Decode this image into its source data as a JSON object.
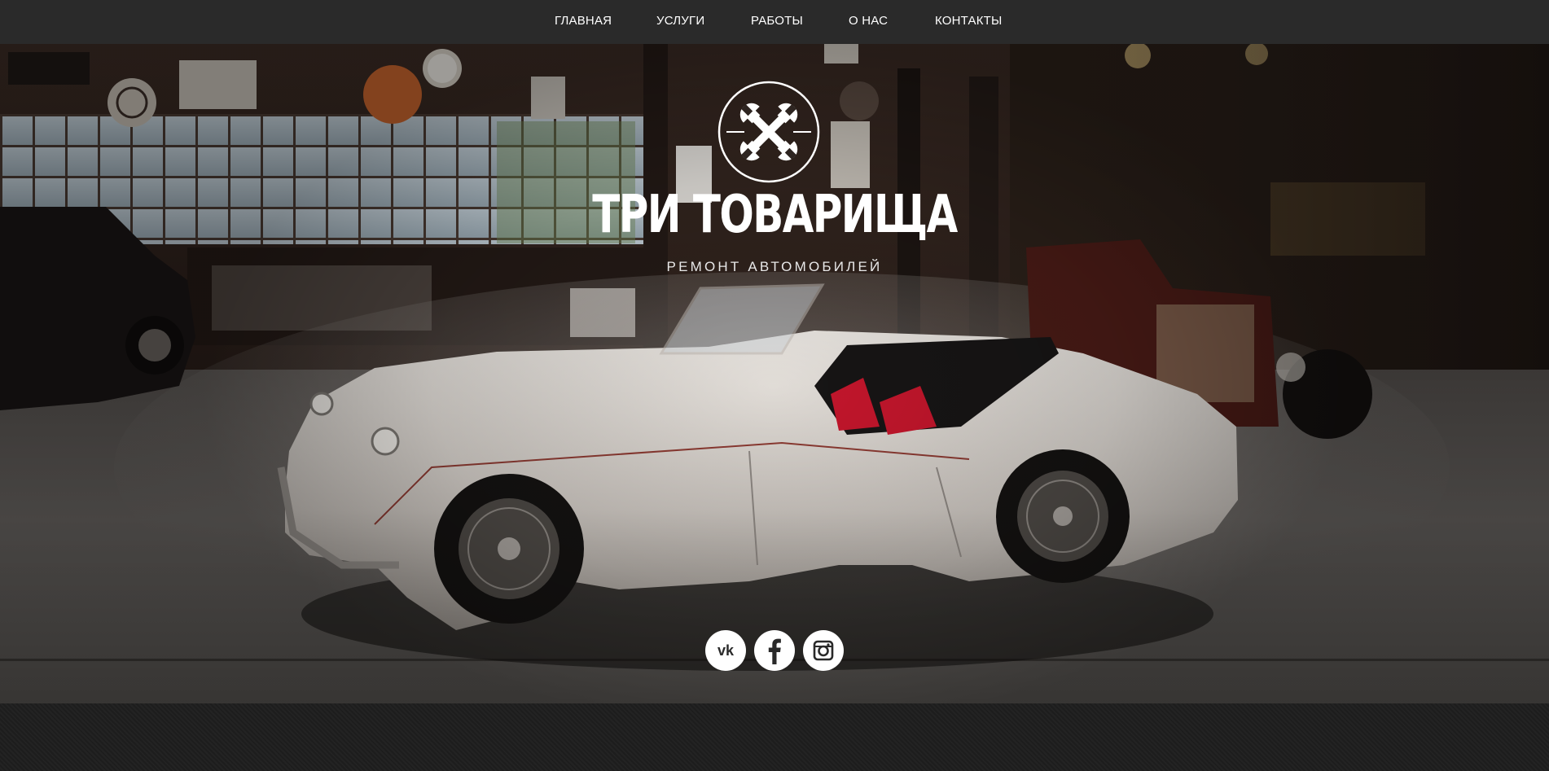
{
  "nav": {
    "items": [
      {
        "label": "ГЛАВНАЯ"
      },
      {
        "label": "УСЛУГИ"
      },
      {
        "label": "РАБОТЫ"
      },
      {
        "label": "О НАС"
      },
      {
        "label": "КОНТАКТЫ"
      }
    ]
  },
  "hero": {
    "title": "ТРИ ТОВАРИЩА",
    "subtitle": "РЕМОНТ АВТОМОБИЛЕЙ",
    "logo_icon": "crossed-wrenches-icon"
  },
  "social": [
    {
      "icon": "vk-icon"
    },
    {
      "icon": "facebook-icon"
    },
    {
      "icon": "instagram-icon"
    }
  ],
  "colors": {
    "nav_bg": "#2a2a2a",
    "text": "#ffffff",
    "car_body": "#d7d2cc",
    "seat_red": "#c4162c",
    "bottom_band": "#1f1f1f"
  }
}
